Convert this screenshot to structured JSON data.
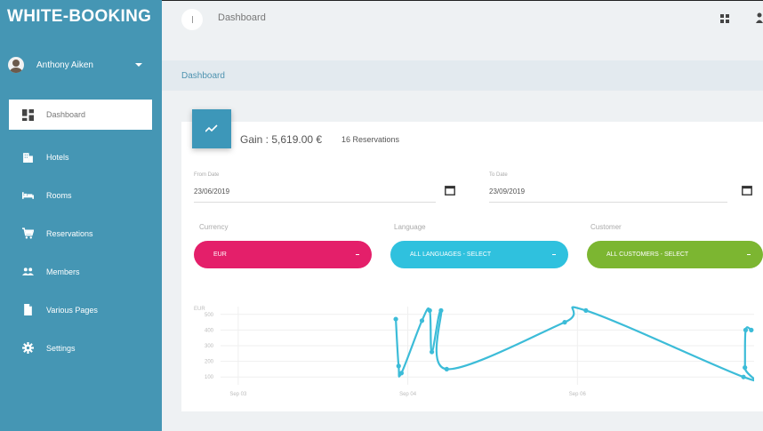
{
  "app": {
    "brand": "WHITE-BOOKING"
  },
  "user": {
    "name": "Anthony Aiken"
  },
  "sidebar": {
    "items": [
      {
        "label": "Dashboard",
        "icon": "dashboard-icon",
        "active": true
      },
      {
        "label": "Hotels",
        "icon": "building-icon"
      },
      {
        "label": "Rooms",
        "icon": "bed-icon"
      },
      {
        "label": "Reservations",
        "icon": "cart-icon"
      },
      {
        "label": "Members",
        "icon": "people-icon"
      },
      {
        "label": "Various Pages",
        "icon": "file-icon"
      },
      {
        "label": "Settings",
        "icon": "gear-icon"
      }
    ]
  },
  "topbar": {
    "title": "Dashboard"
  },
  "breadcrumb": {
    "current": "Dashboard"
  },
  "summary": {
    "gain": "Gain : 5,619.00 €",
    "reservations": "16 Reservations"
  },
  "filters": {
    "from_label": "From Date",
    "from_value": "23/06/2019",
    "to_label": "To Date",
    "to_value": "23/09/2019",
    "currency_label": "Currency",
    "currency_value": "EUR",
    "language_label": "Language",
    "language_value": "ALL LANGUAGES - SELECT",
    "customer_label": "Customer",
    "customer_value": "ALL CUSTOMERS - SELECT"
  },
  "colors": {
    "sidebar": "#4596b4",
    "accent": "#3d97b9",
    "currency": "#e41f6a",
    "language": "#2fc1de",
    "customer": "#7cb631",
    "line": "#3cbcd8"
  },
  "chart_data": {
    "type": "line",
    "ylabel": "EUR",
    "yticks": [
      "100",
      "200",
      "300",
      "400",
      "500"
    ],
    "ylim": [
      50,
      550
    ],
    "xticks": [
      {
        "label": "Sep 03",
        "x": 0
      },
      {
        "label": "Sep 04",
        "x": 24
      },
      {
        "label": "Sep 06",
        "x": 48
      }
    ],
    "xlim": [
      -2.5,
      73
    ],
    "series": [
      {
        "points": [
          {
            "x": 22.3,
            "y": 470
          },
          {
            "x": 22.7,
            "y": 170
          },
          {
            "x": 23.1,
            "y": 125
          },
          {
            "x": 26.0,
            "y": 460
          },
          {
            "x": 27.1,
            "y": 525
          },
          {
            "x": 27.4,
            "y": 260
          },
          {
            "x": 28.7,
            "y": 525
          },
          {
            "x": 29.5,
            "y": 150
          },
          {
            "x": 46.2,
            "y": 450
          },
          {
            "x": 49.2,
            "y": 525
          },
          {
            "x": 71.5,
            "y": 100
          },
          {
            "x": 71.7,
            "y": 160
          },
          {
            "x": 71.8,
            "y": 400
          },
          {
            "x": 72.6,
            "y": 400
          }
        ]
      }
    ]
  }
}
